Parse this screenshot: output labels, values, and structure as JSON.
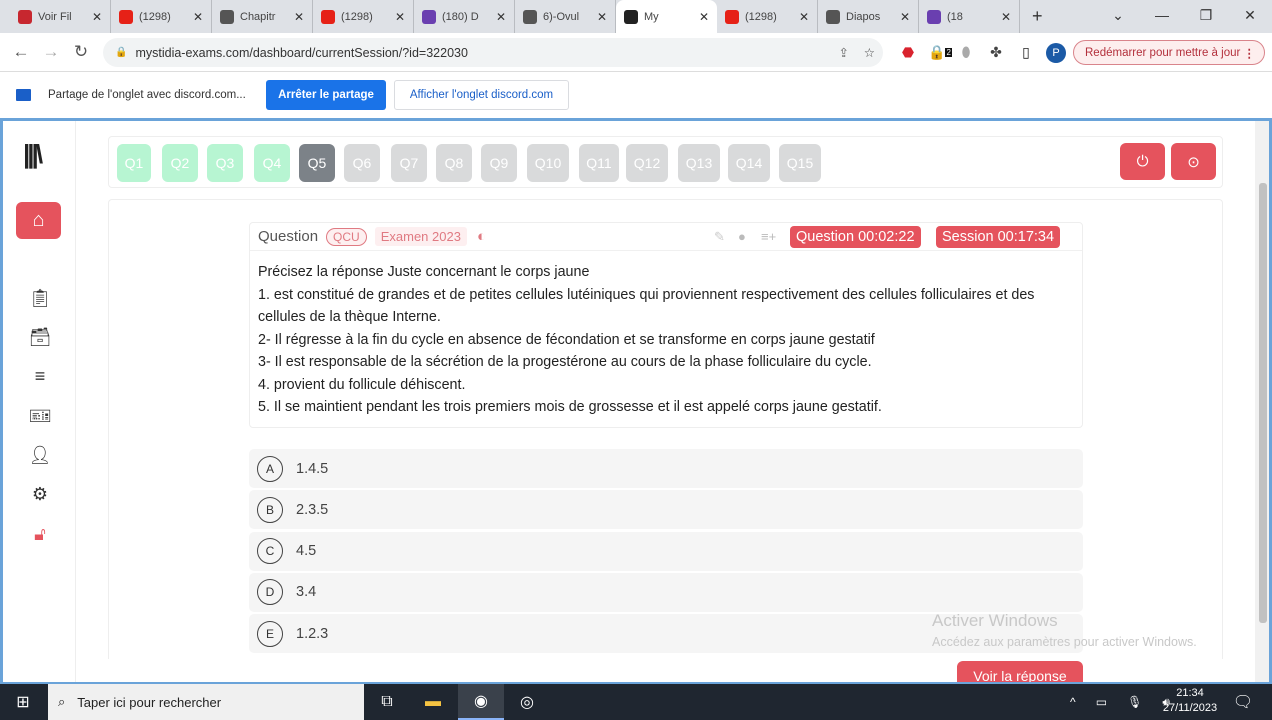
{
  "browser": {
    "tabs": [
      {
        "title": "Voir Fil",
        "color": "#c7272f"
      },
      {
        "title": "(1298)",
        "color": "#e62117"
      },
      {
        "title": "Chapitr",
        "color": "#555555"
      },
      {
        "title": "(1298)",
        "color": "#e62117"
      },
      {
        "title": "(180) D",
        "color": "#6a3fb0"
      },
      {
        "title": "6)-Ovul",
        "color": "#555555"
      },
      {
        "title": "My",
        "color": "#222222",
        "active": true
      },
      {
        "title": "(1298)",
        "color": "#e62117"
      },
      {
        "title": "Diapos",
        "color": "#555555"
      },
      {
        "title": "(18",
        "color": "#6a3fb0"
      }
    ],
    "url": "mystidia-exams.com/dashboard/currentSession/?id=322030",
    "restart_label": "Redémarrer pour mettre à jour",
    "profile_initial": "P",
    "extension_badge": "2",
    "share_bar": {
      "text": "Partage de l'onglet avec discord.com...",
      "stop_label": "Arrêter le partage",
      "show_label": "Afficher l'onglet discord.com"
    }
  },
  "questions_nav": {
    "items": [
      "Q1",
      "Q2",
      "Q3",
      "Q4",
      "Q5",
      "Q6",
      "Q7",
      "Q8",
      "Q9",
      "Q10",
      "Q11",
      "Q12",
      "Q13",
      "Q14",
      "Q15"
    ],
    "answered": 4,
    "current": "Q5"
  },
  "question": {
    "label": "Question",
    "type_tag": "QCU",
    "exam_tag": "Examen 2023",
    "question_timer": "Question 00:02:22",
    "session_timer": "Session 00:17:34",
    "lines": [
      "Précisez la réponse Juste concernant le corps jaune",
      "1. est constitué de grandes et de petites cellules lutéiniques qui proviennent respectivement des cellules folliculaires et des cellules de la thèque Interne.",
      "2- Il régresse à la fin du cycle en absence de fécondation et se transforme en corps jaune gestatif",
      "3- Il est responsable de la sécrétion de la progestérone au cours de la phase folliculaire du cycle.",
      "4. provient du follicule déhiscent.",
      "5. Il se maintient pendant les trois premiers mois de grossesse et il est appelé corps jaune gestatif."
    ]
  },
  "options": [
    {
      "letter": "A",
      "text": "1.4.5"
    },
    {
      "letter": "B",
      "text": "2.3.5"
    },
    {
      "letter": "C",
      "text": "4.5"
    },
    {
      "letter": "D",
      "text": "3.4"
    },
    {
      "letter": "E",
      "text": "1.2.3"
    }
  ],
  "show_answer_label": "Voir la réponse",
  "watermark": {
    "title": "Activer Windows",
    "subtitle": "Accédez aux paramètres pour activer Windows."
  },
  "taskbar": {
    "search_placeholder": "Taper ici pour rechercher",
    "time": "21:34",
    "date": "27/11/2023"
  }
}
